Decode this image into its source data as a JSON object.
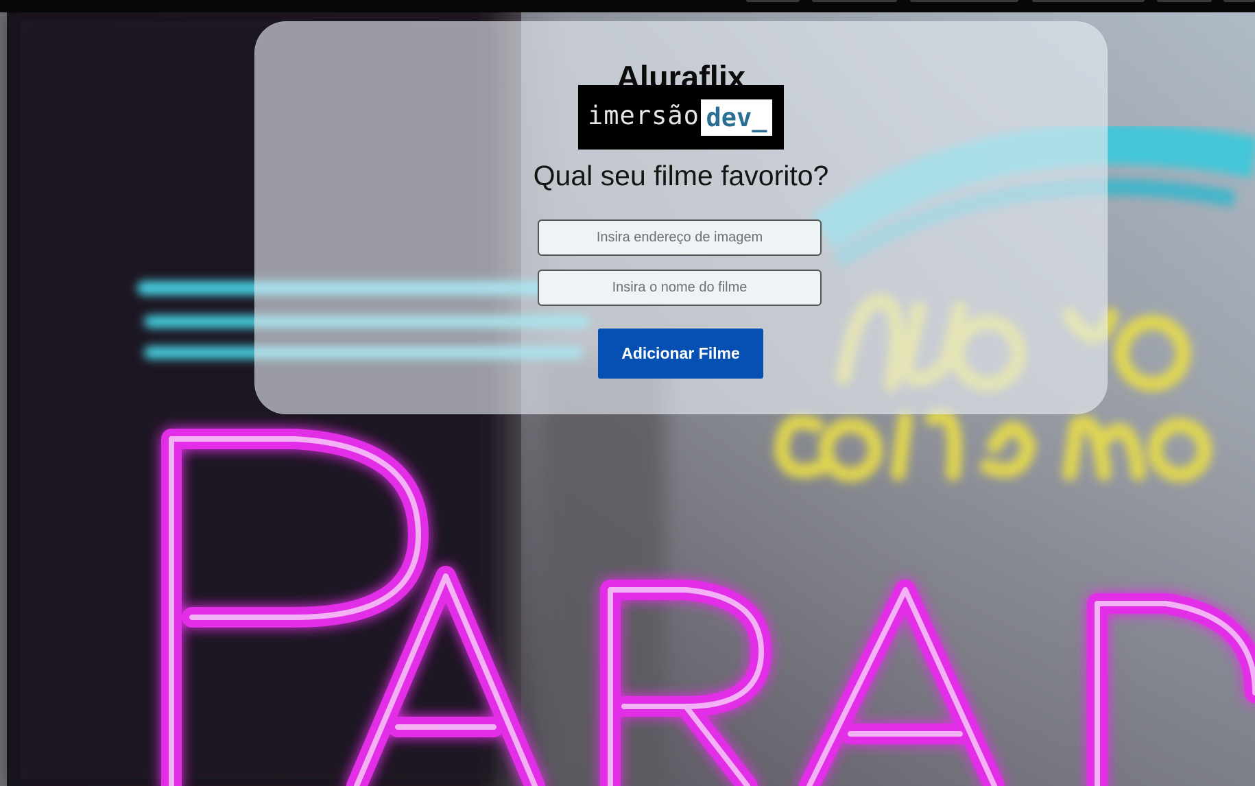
{
  "app": {
    "title": "Aluraflix",
    "subtitle": "Qual seu filme favorito?"
  },
  "logo": {
    "word1": "imersão",
    "word2": "dev_"
  },
  "form": {
    "image_placeholder": "Insira endereço de imagem",
    "image_value": "",
    "name_placeholder": "Insira o nome do filme",
    "name_value": "",
    "submit_label": "Adicionar Filme"
  },
  "background": {
    "sign_word": "PARAD",
    "neon_script_line1": "nuovo",
    "neon_script_line2": "cinema"
  },
  "colors": {
    "accent": "#0650b4",
    "logo_dev_text": "#2a6e93",
    "neon_pink": "#e22ee6",
    "neon_yellow": "#e8dc4a",
    "neon_cyan": "#39c9dc"
  }
}
